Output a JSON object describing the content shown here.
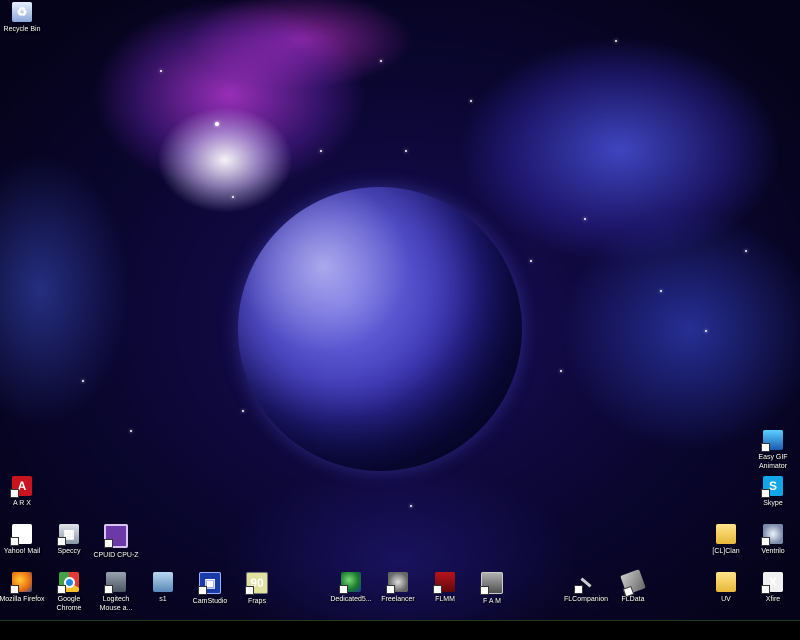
{
  "desktop": {
    "icons": {
      "recycle_bin": {
        "label": "Recycle Bin",
        "icon": "recycle-bin-icon"
      },
      "arx": {
        "label": "A R X",
        "icon": "acrobat-icon"
      },
      "yahoo_mail": {
        "label": "Yahoo! Mail",
        "icon": "yahoo-icon"
      },
      "speccy": {
        "label": "Speccy",
        "icon": "speccy-icon"
      },
      "cpuid": {
        "label": "CPUID CPU-Z",
        "icon": "cpuz-icon"
      },
      "firefox": {
        "label": "Mozilla Firefox",
        "icon": "firefox-icon"
      },
      "chrome": {
        "label": "Google\nChrome",
        "icon": "chrome-icon"
      },
      "logitech": {
        "label": "Logitech\nMouse a...",
        "icon": "mouse-icon"
      },
      "s1": {
        "label": "s1",
        "icon": "image-icon"
      },
      "camstudio": {
        "label": "CamStudio",
        "icon": "camstudio-icon"
      },
      "fraps": {
        "label": "Fraps",
        "icon": "fraps-icon"
      },
      "dedicated": {
        "label": "Dedicated5...",
        "icon": "globe-icon"
      },
      "freelancer": {
        "label": "Freelancer",
        "icon": "freelancer-icon"
      },
      "flmm": {
        "label": "FLMM",
        "icon": "flmm-icon"
      },
      "fam": {
        "label": "F A M",
        "icon": "fam-icon"
      },
      "flcompanion": {
        "label": "FLCompanion",
        "icon": "satellite-icon"
      },
      "fldata": {
        "label": "FLData",
        "icon": "ship-icon"
      },
      "easygif": {
        "label": "Easy GIF\nAnimator",
        "icon": "gif-icon"
      },
      "skype": {
        "label": "Skype",
        "icon": "skype-icon"
      },
      "clan": {
        "label": "[CL]Clan",
        "icon": "folder-icon"
      },
      "ventrilo": {
        "label": "Ventrilo",
        "icon": "ventrilo-icon"
      },
      "uv": {
        "label": "UV",
        "icon": "folder-icon"
      },
      "xfire": {
        "label": "Xfire",
        "icon": "xfire-icon"
      }
    }
  },
  "colors": {
    "label_text": "#ffffff",
    "taskbar": "#000000"
  }
}
